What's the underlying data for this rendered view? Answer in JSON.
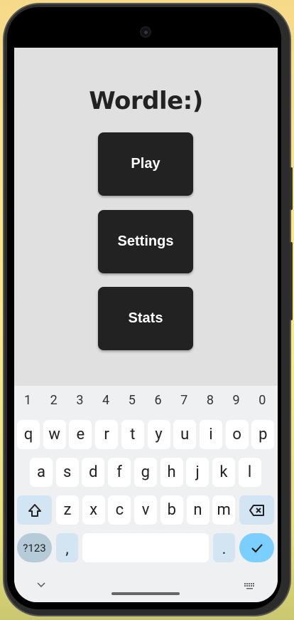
{
  "app": {
    "title": "Wordle:)",
    "buttons": [
      {
        "label": "Play"
      },
      {
        "label": "Settings"
      },
      {
        "label": "Stats"
      }
    ]
  },
  "keyboard": {
    "numbers": [
      "1",
      "2",
      "3",
      "4",
      "5",
      "6",
      "7",
      "8",
      "9",
      "0"
    ],
    "row1": [
      "q",
      "w",
      "e",
      "r",
      "t",
      "y",
      "u",
      "i",
      "o",
      "p"
    ],
    "row2": [
      "a",
      "s",
      "d",
      "f",
      "g",
      "h",
      "j",
      "k",
      "l"
    ],
    "row3": [
      "z",
      "x",
      "c",
      "v",
      "b",
      "n",
      "m"
    ],
    "symbols_label": "?123",
    "comma": ",",
    "period": ".",
    "shift_icon": "shift-icon",
    "backspace_icon": "backspace-icon",
    "enter_icon": "check-icon",
    "colors": {
      "background": "#eff0f2",
      "special_key": "#d3e4f3",
      "enter": "#7acfff",
      "symbols": "#b5cbd8"
    }
  },
  "navbar": {
    "left_icon": "chevron-down-icon",
    "right_icon": "keyboard-icon"
  }
}
